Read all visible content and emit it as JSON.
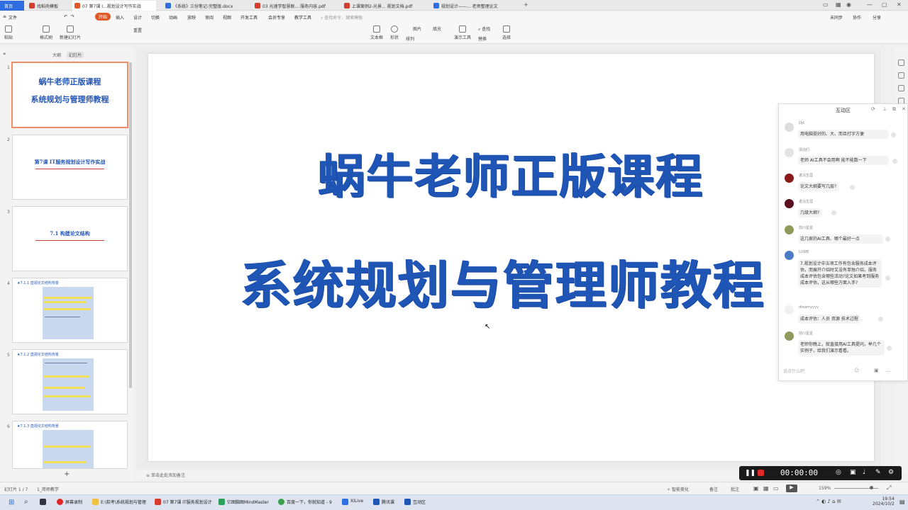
{
  "tabs": [
    {
      "label": "首页"
    },
    {
      "label": "找稻壳模板"
    },
    {
      "label": "07 第7课 I...规划设计写作实战"
    },
    {
      "label": "《系统》三份笔记-完整版.docx"
    },
    {
      "label": "03 光速学智慧联... 服务内容.pdf"
    },
    {
      "label": "上课案例2-光景... 规划文档.pdf"
    },
    {
      "label": "规划设计——... 老师整理论文"
    }
  ],
  "window_controls": {
    "unsaved": "未同步",
    "collab": "协作",
    "share": "分享"
  },
  "menus": [
    "文件",
    "开始",
    "插入",
    "设计",
    "切换",
    "动画",
    "放映",
    "审阅",
    "视图",
    "开发工具",
    "会员专享",
    "教学工具"
  ],
  "search_placeholder": "查找命令、搜索模板",
  "toolbar": {
    "paste": "粘贴",
    "format_painter": "格式刷",
    "new_slide": "新建幻灯片",
    "reset": "重置",
    "textbox": "文本框",
    "shape": "形状",
    "arrange": "排列",
    "image": "图片",
    "fill": "填充",
    "presenter": "演示工具",
    "find": "查找",
    "replace": "替换",
    "select": "选择"
  },
  "view_tabs": {
    "outline": "大纲",
    "slides": "幻灯片"
  },
  "slides": [
    {
      "num": "1",
      "line1": "蜗牛老师正版课程",
      "line2": "系统规划与管理师教程"
    },
    {
      "num": "2",
      "title": "第7课 IT服务规划设计写作实战"
    },
    {
      "num": "3",
      "title": "7.1 构建论文结构"
    },
    {
      "num": "4",
      "title": "★7.1.1 直视论文结构背景"
    },
    {
      "num": "5",
      "title": "★7.1.2 直视论文结构背景"
    },
    {
      "num": "6",
      "title": "★7.1.3 直视论文结构背景"
    }
  ],
  "main_slide": {
    "line1": "蜗牛老师正版课程",
    "line2": "系统规划与管理师教程"
  },
  "notes_placeholder": "单击此处添加备注",
  "status": {
    "slide_counter": "幻灯片 1 / 7",
    "theme": "1_简师教学",
    "smart_beautify": "智能美化",
    "notes": "备注",
    "comment": "批注",
    "zoom": "159%"
  },
  "chat": {
    "title": "互动区",
    "messages": [
      {
        "name": "Ojk",
        "text": "用电脑挺好的、大、而且打字方便"
      },
      {
        "name": "漂泊们",
        "text": "老师 AI工具不会用啊 能不能数一下"
      },
      {
        "name": "诺马生涯",
        "text": "论文大纲要写几层?"
      },
      {
        "name": "诺马生涯",
        "text": "几级大纲?"
      },
      {
        "name": "前川星星",
        "text": "这几家的AI工具、哪个最好一点"
      },
      {
        "name": "LUWE",
        "text": "7.规划设计中五项工作有包含服务成本评估，而展开介绍时又没有单独介绍，服务成本评估包含哪些活动?论文如果考到服务成本评估，这从哪些方面入手?"
      },
      {
        "name": "dreamyyyy",
        "text": "成本评估：人员 资源 技术过程"
      },
      {
        "name": "前川星星",
        "text": "老师你晚上，就直接用AI工具提问，举几个实例子，给我们演示看看。"
      }
    ],
    "input_placeholder": "说点什么吧"
  },
  "recorder": {
    "time": "00:00:00"
  },
  "taskbar": {
    "items": [
      "屏幕录制",
      "E:\\软考\\系统规划与管理",
      "07 第7课 IT服务规划设计",
      "亿图脑图MindMaster",
      "百度一下，你就知道 - 9",
      "XiLive",
      "腾讯课",
      "互动区"
    ],
    "time": "19:54",
    "date": "2024/10/2"
  },
  "colors": {
    "accent": "#e05a28",
    "title_blue": "#1f55b5",
    "home_tab": "#2f6ee0"
  }
}
